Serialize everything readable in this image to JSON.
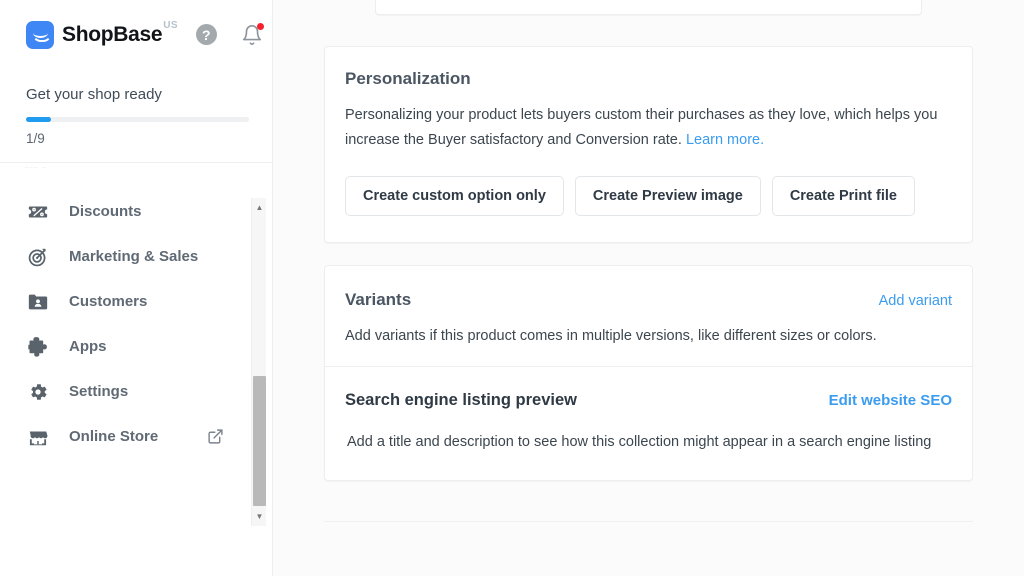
{
  "sidebar": {
    "brand": {
      "name": "ShopBase",
      "region": "US",
      "logo_icon": "shopbase-logo-icon",
      "help_icon": "help-question-icon",
      "help_label": "?",
      "notifications_icon": "bell-icon",
      "has_notification_badge": true
    },
    "onboarding": {
      "title": "Get your shop ready",
      "progress_label": "1/9",
      "progress_current": 1,
      "progress_total": 9,
      "progress_percent": 11,
      "accent_color": "#1f9bf0"
    },
    "clipped_row_text": "--- -",
    "items": [
      {
        "label": "Discounts",
        "icon": "discount-tag-icon",
        "external": false
      },
      {
        "label": "Marketing & Sales",
        "icon": "target-icon",
        "external": false
      },
      {
        "label": "Customers",
        "icon": "customers-folder-icon",
        "external": false
      },
      {
        "label": "Apps",
        "icon": "puzzle-piece-icon",
        "external": false
      },
      {
        "label": "Settings",
        "icon": "gear-icon",
        "external": false
      },
      {
        "label": "Online Store",
        "icon": "storefront-icon",
        "external": true,
        "external_icon": "external-link-icon"
      }
    ],
    "scrollbar": {
      "up_icon": "scroll-up-arrow-icon",
      "down_icon": "scroll-down-arrow-icon"
    }
  },
  "main": {
    "personalization": {
      "title": "Personalization",
      "description": "Personalizing your product lets buyers custom their purchases as they love, which helps you increase the Buyer satisfactory and Conversion rate.",
      "learn_more": "Learn more.",
      "buttons": [
        "Create custom option only",
        "Create Preview image",
        "Create Print file"
      ]
    },
    "variants": {
      "title": "Variants",
      "action_label": "Add variant",
      "description": "Add variants if this product comes in multiple versions, like different sizes or colors."
    },
    "seo": {
      "title": "Search engine listing preview",
      "action_label": "Edit website SEO",
      "description": "Add a title and description to see how this collection might appear in a search engine listing"
    },
    "link_color": "#3b9cf0"
  }
}
